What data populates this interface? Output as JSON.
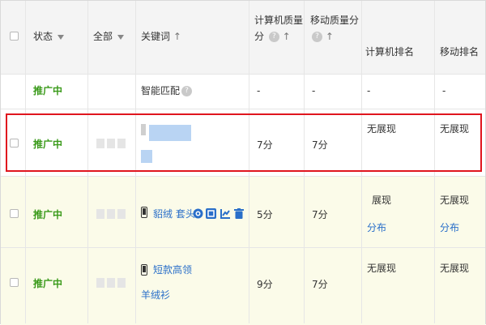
{
  "header": {
    "status": "状态",
    "all": "全部",
    "keyword": "关键词",
    "pc_quality": "计算机质量分",
    "mobile_quality": "移动质量分",
    "pc_rank": "计算机排名",
    "mobile_rank": "移动排名"
  },
  "rows": [
    {
      "status": "推广中",
      "keyword": "智能匹配",
      "pc_quality": "-",
      "mobile_quality": "-",
      "pc_rank": "-",
      "mobile_rank": "-"
    },
    {
      "status": "推广中",
      "pc_quality": "7分",
      "mobile_quality": "7分",
      "pc_rank": "无展现",
      "mobile_rank": "无展现"
    },
    {
      "status": "推广中",
      "keyword": "貂绒 套头",
      "pc_quality": "5分",
      "mobile_quality": "7分",
      "pc_rank": "展现",
      "pc_rank_link": "分布",
      "mobile_rank": "无展现",
      "mobile_rank_link": "分布"
    },
    {
      "status": "推广中",
      "keyword_line1": "短款高领",
      "keyword_line2": "羊绒衫",
      "pc_quality": "9分",
      "mobile_quality": "7分",
      "pc_rank": "无展现",
      "mobile_rank": "无展现"
    }
  ],
  "colors": {
    "green_status": "#3a9a1a",
    "link_blue": "#2a6fc9",
    "highlight_red": "#e0151e",
    "row_yellow": "#fbfbe9"
  }
}
